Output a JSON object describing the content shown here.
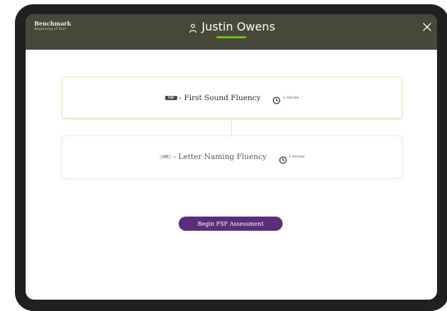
{
  "header": {
    "title": "Benchmark",
    "subtitle": "Beginning of Year",
    "student_name": "Justin Owens",
    "icons": {
      "student": "person-icon",
      "close": "close-icon"
    },
    "accent_color": "#6cc018",
    "background_color": "#484838"
  },
  "assessments": [
    {
      "badge": "FSF",
      "name": "- First Sound Fluency",
      "duration": "1 minute",
      "active": true
    },
    {
      "badge": "LNF",
      "name": "- Letter Naming Fluency",
      "duration": "1 minute",
      "active": false
    }
  ],
  "action": {
    "begin_label": "Begin FSF Assessment",
    "button_color": "#5a2e79"
  }
}
